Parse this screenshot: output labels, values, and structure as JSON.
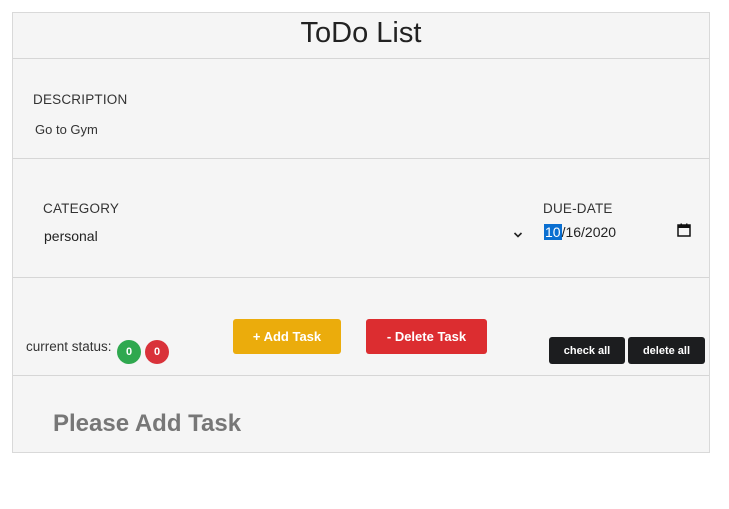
{
  "app": {
    "title": "ToDo List"
  },
  "description": {
    "label": "DESCRIPTION",
    "value": "Go to Gym"
  },
  "category": {
    "label": "CATEGORY",
    "selected": "personal"
  },
  "due_date": {
    "label": "DUE-DATE",
    "month": "10",
    "rest": "/16/2020"
  },
  "actions": {
    "status_label": "current status:",
    "completed_count": "0",
    "pending_count": "0",
    "add_label": "+ Add Task",
    "delete_label": "- Delete Task",
    "check_all_label": "check all",
    "delete_all_label": "delete all"
  },
  "list": {
    "empty_message": "Please Add Task"
  },
  "colors": {
    "add_button": "#ebac0c",
    "delete_button": "#dc2d30",
    "dark_button": "#1c1d1f",
    "badge_green": "#2fa84f",
    "badge_red": "#d9323a"
  },
  "icons": [
    "chevron-down-icon",
    "calendar-icon"
  ]
}
